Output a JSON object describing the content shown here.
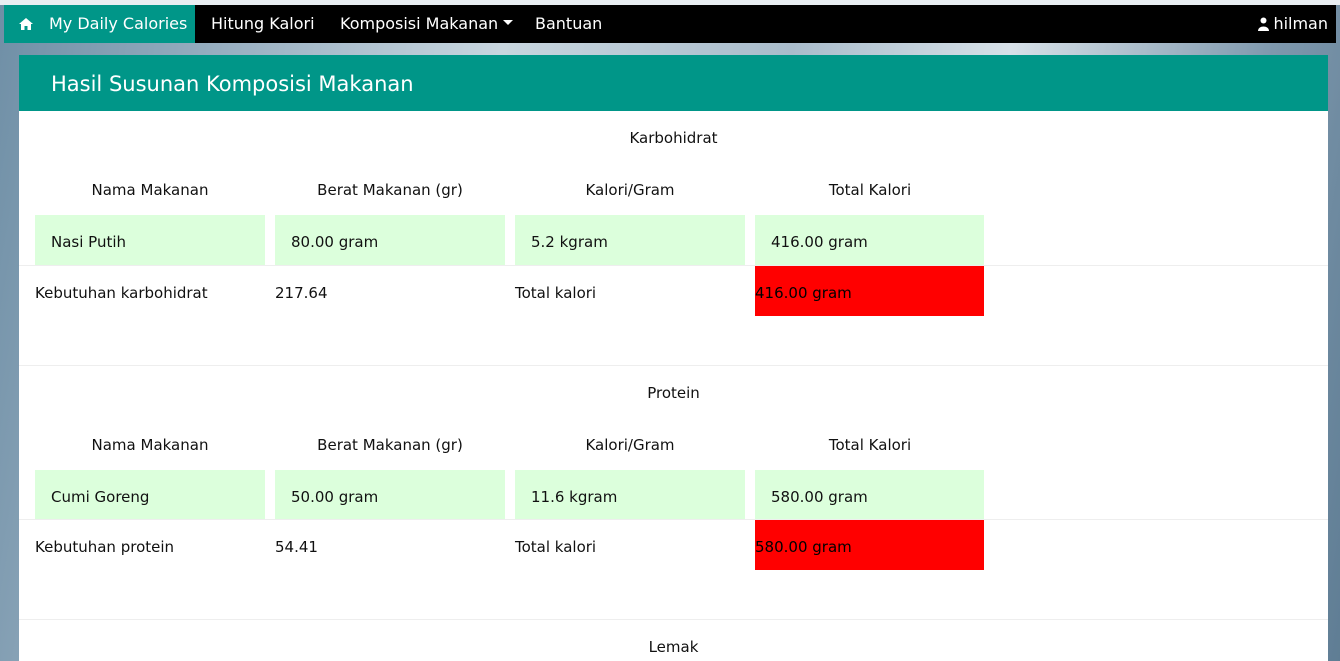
{
  "nav": {
    "brand": "My Daily Calories",
    "items": [
      "Hitung Kalori",
      "Komposisi Makanan",
      "Bantuan"
    ],
    "user": "hilman",
    "accent": "#009688"
  },
  "panel": {
    "title": "Hasil Susunan Komposisi Makanan"
  },
  "columns": [
    "Nama Makanan",
    "Berat Makanan (gr)",
    "Kalori/Gram",
    "Total Kalori"
  ],
  "sections": [
    {
      "title": "Karbohidrat",
      "row": [
        "Nasi Putih",
        "80.00 gram",
        "5.2 kgram",
        "416.00 gram"
      ],
      "need_label": "Kebutuhan karbohidrat",
      "need_value": "217.64",
      "total_label": "Total kalori",
      "total_value": "416.00 gram"
    },
    {
      "title": "Protein",
      "row": [
        "Cumi Goreng",
        "50.00 gram",
        "11.6 kgram",
        "580.00 gram"
      ],
      "need_label": "Kebutuhan protein",
      "need_value": "54.41",
      "total_label": "Total kalori",
      "total_value": "580.00 gram"
    },
    {
      "title": "Lemak"
    }
  ]
}
